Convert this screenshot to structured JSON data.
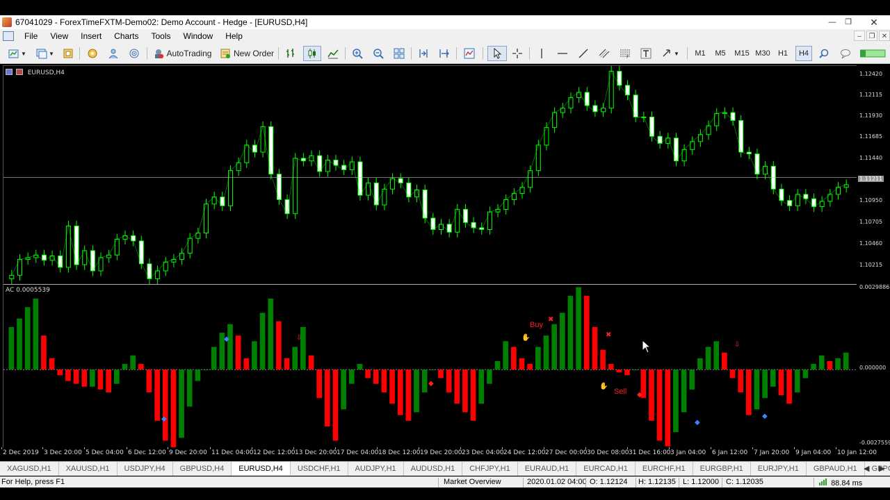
{
  "window": {
    "title": "67041029 - ForexTimeFXTM-Demo02: Demo Account - Hedge - [EURUSD,H4]",
    "controls": [
      "minimize",
      "restore",
      "close"
    ]
  },
  "menu": {
    "items": [
      "File",
      "View",
      "Insert",
      "Charts",
      "Tools",
      "Window",
      "Help"
    ]
  },
  "toolbar": {
    "autotrading_label": "AutoTrading",
    "new_order_label": "New Order",
    "timeframes": [
      "M1",
      "M5",
      "M15",
      "M30",
      "H1",
      "H4"
    ],
    "active_timeframe": "H4"
  },
  "main_chart": {
    "label": "EURUSD,H4",
    "price_ticks": [
      "1.12420",
      "1.12115",
      "1.11930",
      "1.11685",
      "1.11440",
      "1.11211",
      "1.10950",
      "1.10705",
      "1.10460",
      "1.10215"
    ],
    "current_price": "1.11211",
    "colors": {
      "bull": "#00ff00",
      "bear": "#ffffff",
      "bid_line": "#c0c0c0",
      "background": "#000000"
    }
  },
  "indicator": {
    "label": "AC 0.0005539",
    "axis_ticks": [
      "0.0029886",
      "0.000000",
      "-0.0027559"
    ],
    "annotations": {
      "buy": "Buy",
      "sell": "Sell"
    },
    "colors": {
      "up": "#008000",
      "down": "#ff0000",
      "annotation": "#ff2020",
      "diamond": "#3a86ff"
    }
  },
  "time_axis": [
    "2 Dec 2019",
    "3 Dec 20:00",
    "5 Dec 04:00",
    "6 Dec 12:00",
    "9 Dec 20:00",
    "11 Dec 04:00",
    "12 Dec 12:00",
    "13 Dec 20:00",
    "17 Dec 04:00",
    "18 Dec 12:00",
    "19 Dec 20:00",
    "23 Dec 04:00",
    "24 Dec 12:00",
    "27 Dec 00:00",
    "30 Dec 08:00",
    "31 Dec 16:00",
    "3 Jan 04:00",
    "6 Jan 12:00",
    "7 Jan 20:00",
    "9 Jan 04:00",
    "10 Jan 12:00"
  ],
  "symbol_tabs": [
    "XAGUSD,H1",
    "XAUUSD,H1",
    "USDJPY,H4",
    "GBPUSD,H4",
    "EURUSD,H4",
    "USDCHF,H1",
    "AUDJPY,H1",
    "AUDUSD,H1",
    "CHFJPY,H1",
    "EURAUD,H1",
    "EURCAD,H1",
    "EURCHF,H1",
    "EURGBP,H1",
    "EURJPY,H1",
    "GBPAUD,H1",
    "GBPC"
  ],
  "active_tab": "EURUSD,H4",
  "status": {
    "help": "For Help, press F1",
    "profile": "Market Overview",
    "datetime": "2020.01.02 04:00",
    "open": "O: 1.12124",
    "high": "H: 1.12135",
    "low": "L: 1.12000",
    "close": "C: 1.12035",
    "ping": "88.84 ms"
  },
  "chart_data": [
    {
      "type": "line",
      "title": "EURUSD,H4",
      "series": [
        {
          "name": "EURUSD,H4",
          "values": [
            1.101,
            1.1028,
            1.103,
            1.1033,
            1.1027,
            1.1032,
            1.1019,
            1.1066,
            1.1022,
            1.1038,
            1.1015,
            1.103,
            1.1033,
            1.1051,
            1.1055,
            1.1049,
            1.1023,
            1.1006,
            1.1015,
            1.1025,
            1.1028,
            1.1035,
            1.1052,
            1.1058,
            1.1091,
            1.1099,
            1.1089,
            1.1129,
            1.1138,
            1.1158,
            1.115,
            1.1179,
            1.1125,
            1.1096,
            1.108,
            1.1143,
            1.114,
            1.1146,
            1.1128,
            1.1141,
            1.1135,
            1.113,
            1.1139,
            1.1101,
            1.1115,
            1.109,
            1.1108,
            1.112,
            1.1115,
            1.1099,
            1.1107,
            1.1075,
            1.1062,
            1.1068,
            1.1059,
            1.1085,
            1.107,
            1.1064,
            1.1062,
            1.1082,
            1.1085,
            1.1096,
            1.1103,
            1.111,
            1.1129,
            1.1158,
            1.1178,
            1.1195,
            1.12,
            1.1212,
            1.1218,
            1.1203,
            1.1196,
            1.12,
            1.1242,
            1.1226,
            1.1215,
            1.119,
            1.119,
            1.1168,
            1.116,
            1.1166,
            1.114,
            1.1153,
            1.1162,
            1.117,
            1.118,
            1.1194,
            1.1195,
            1.1186,
            1.115,
            1.1148,
            1.1125,
            1.1134,
            1.1108,
            1.1095,
            1.1089,
            1.1102,
            1.1097,
            1.1088,
            1.1094,
            1.1102,
            1.111,
            1.1113
          ]
        }
      ],
      "x_range": [
        "2 Dec 2019",
        "10 Jan 12:00"
      ],
      "ylim": [
        1.1,
        1.1248
      ],
      "y_ticks": [
        1.1242,
        1.12115,
        1.1193,
        1.11685,
        1.1144,
        1.11211,
        1.1095,
        1.10705,
        1.1046,
        1.10215
      ]
    },
    {
      "type": "bar",
      "title": "AC 0.0005539",
      "series": [
        {
          "name": "AC",
          "values": [
            0.0015,
            0.0018,
            0.0022,
            0.0025,
            0.0012,
            0.0004,
            -0.0002,
            -0.0004,
            -0.0005,
            -0.0006,
            -0.0006,
            -0.0007,
            -0.0008,
            -0.0005,
            0.0002,
            0.0005,
            0.0002,
            -0.0008,
            -0.0018,
            -0.0025,
            -0.0028,
            -0.0024,
            -0.0013,
            -0.0004,
            0.0,
            0.0008,
            0.0013,
            0.0016,
            0.0012,
            0.0004,
            0.001,
            0.002,
            0.0025,
            0.0017,
            0.0004,
            0.0008,
            0.0015,
            0.0005,
            -0.001,
            -0.002,
            -0.0025,
            -0.0014,
            -0.0005,
            0.0002,
            -0.0003,
            -0.0005,
            -0.0008,
            -0.0012,
            -0.0016,
            -0.0018,
            -0.0015,
            -0.0008,
            0.0,
            -0.0003,
            -0.0008,
            -0.0012,
            -0.0015,
            -0.0018,
            -0.0012,
            -0.0005,
            0.0003,
            0.001,
            0.0008,
            0.0004,
            0.0002,
            0.0008,
            0.0012,
            0.0016,
            0.002,
            0.0026,
            0.0029,
            0.0026,
            0.0015,
            0.0007,
            0.0002,
            -0.0001,
            -0.0002,
            0.0,
            -0.001,
            -0.0018,
            -0.0025,
            -0.0027,
            -0.0022,
            -0.0015,
            -0.0007,
            0.0004,
            0.0008,
            0.001,
            0.0006,
            -0.0003,
            -0.0008,
            -0.0016,
            -0.0014,
            -0.001,
            -0.0006,
            -0.0009,
            -0.0012,
            -0.0008,
            -0.0003,
            0.0002,
            0.0005,
            0.0003,
            0.0004,
            0.0006
          ]
        }
      ],
      "ylim": [
        -0.0027559,
        0.0029886
      ],
      "y_ticks": [
        0.0029886,
        0.0,
        -0.0027559
      ]
    }
  ]
}
